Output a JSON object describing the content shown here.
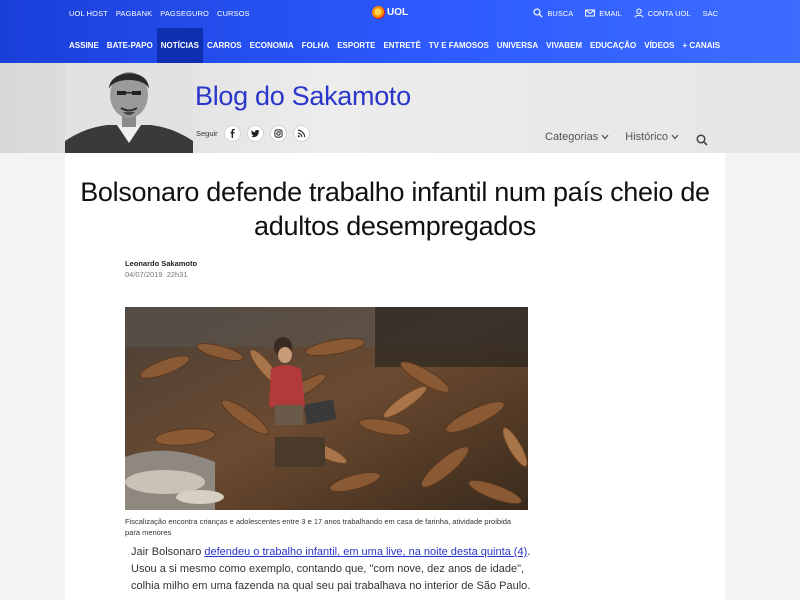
{
  "top_links": [
    "UOL HOST",
    "PAGBANK",
    "PAGSEGURO",
    "CURSOS"
  ],
  "logo_text": "UOL",
  "top_right": {
    "busca": "BUSCA",
    "email": "EMAIL",
    "conta": "CONTA UOL",
    "sac": "SAC"
  },
  "nav": [
    "ASSINE",
    "BATE-PAPO",
    "NOTÍCIAS",
    "CARROS",
    "ECONOMIA",
    "FOLHA",
    "ESPORTE",
    "ENTRETÊ",
    "TV E FAMOSOS",
    "UNIVERSA",
    "VIVABEM",
    "EDUCAÇÃO",
    "VÍDEOS",
    "+ CANAIS"
  ],
  "nav_active": "NOTÍCIAS",
  "blog": {
    "title": "Blog do Sakamoto",
    "follow_label": "Seguir",
    "categorias": "Categorias",
    "historico": "Histórico"
  },
  "article": {
    "headline": "Bolsonaro defende trabalho infantil num país cheio de adultos desempregados",
    "author": "Leonardo Sakamoto",
    "date": "04/07/2019",
    "time": "22h31",
    "caption": "Fiscalização encontra crianças e adolescentes entre 3 e 17 anos trabalhando em casa de farinha, atividade proibida para menores",
    "body_start": "Jair Bolsonaro ",
    "body_link": "defendeu o trabalho infantil, em uma live, na noite desta quinta (4)",
    "body_rest": ". Usou a si mesmo como exemplo, contando que, \"com nove, dez anos de idade\", colhia milho em uma fazenda na qual seu pai trabalhava no interior de São Paulo."
  },
  "colors": {
    "uol_blue": "#2d5bff",
    "blog_title": "#2a35c9",
    "link": "#2a35c9"
  }
}
